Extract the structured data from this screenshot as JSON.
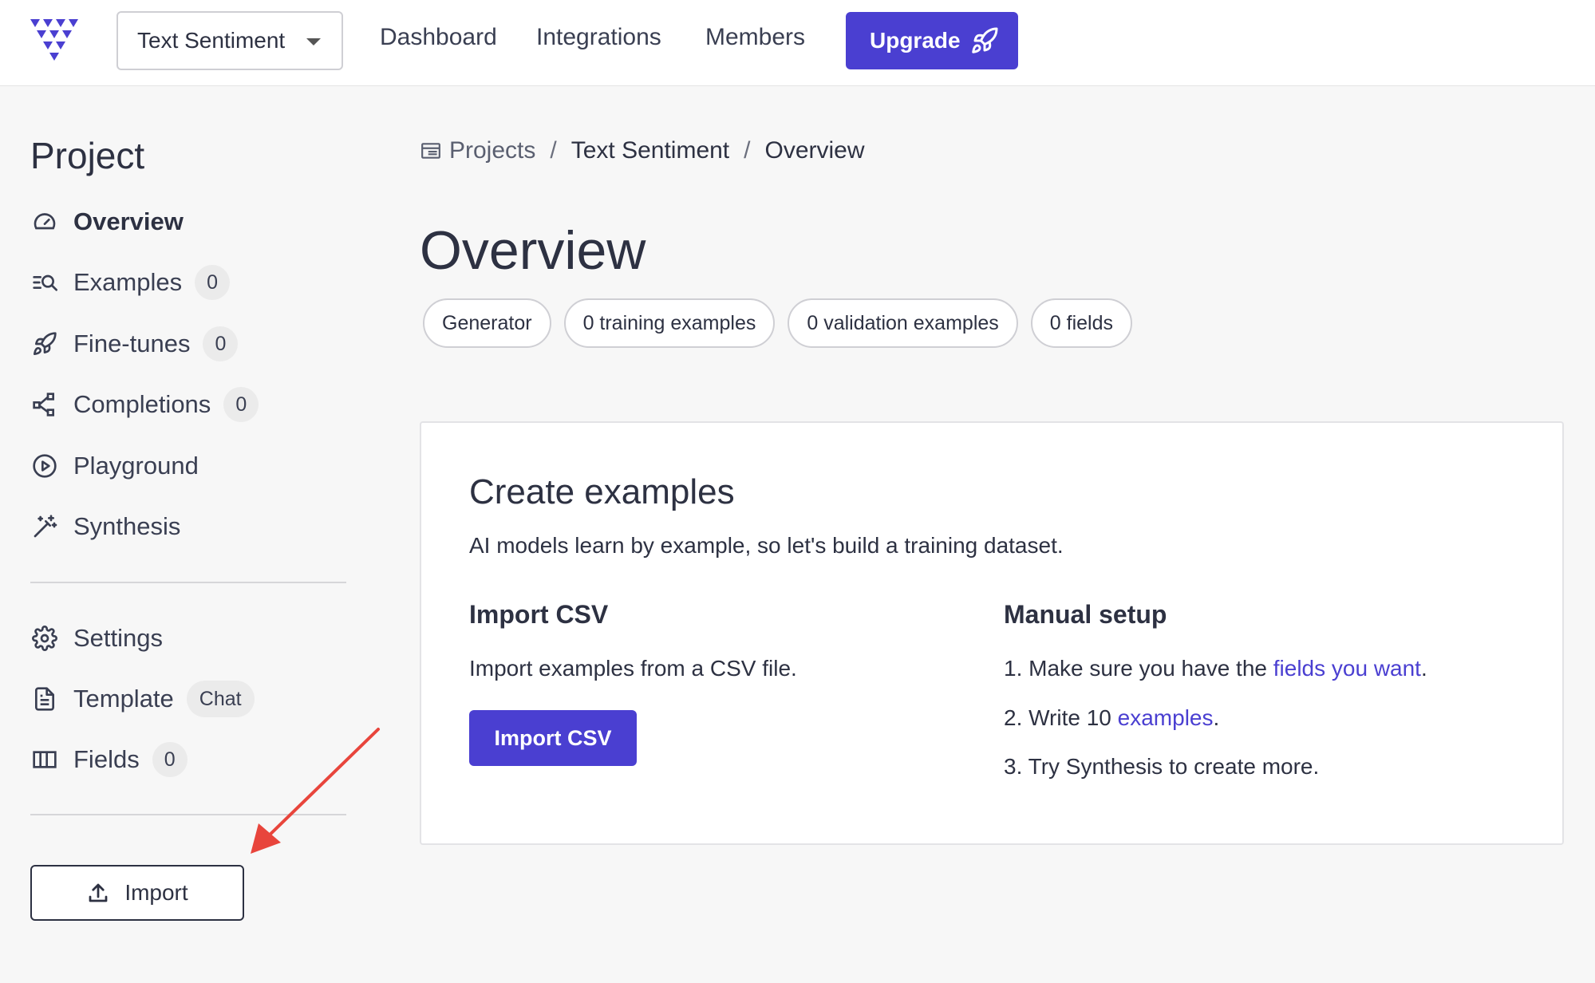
{
  "header": {
    "project_selector": "Text Sentiment",
    "nav": [
      "Dashboard",
      "Integrations",
      "Members"
    ],
    "upgrade_label": "Upgrade"
  },
  "sidebar": {
    "heading": "Project",
    "items": [
      {
        "label": "Overview",
        "icon": "gauge-icon",
        "active": true
      },
      {
        "label": "Examples",
        "icon": "list-search-icon",
        "count": "0"
      },
      {
        "label": "Fine-tunes",
        "icon": "rocket-icon",
        "count": "0"
      },
      {
        "label": "Completions",
        "icon": "share-nodes-icon",
        "count": "0"
      },
      {
        "label": "Playground",
        "icon": "play-circle-icon"
      },
      {
        "label": "Synthesis",
        "icon": "magic-wand-icon"
      }
    ],
    "settings_items": [
      {
        "label": "Settings",
        "icon": "gear-icon"
      },
      {
        "label": "Template",
        "icon": "document-icon",
        "tag": "Chat"
      },
      {
        "label": "Fields",
        "icon": "columns-icon",
        "count": "0"
      }
    ],
    "import_label": "Import"
  },
  "breadcrumb": [
    "Projects",
    "Text Sentiment",
    "Overview"
  ],
  "page_title": "Overview",
  "pills": [
    "Generator",
    "0 training examples",
    "0 validation examples",
    "0 fields"
  ],
  "card": {
    "title": "Create examples",
    "subtitle": "AI models learn by example, so let's build a training dataset.",
    "import_csv": {
      "heading": "Import CSV",
      "text": "Import examples from a CSV file.",
      "button": "Import CSV"
    },
    "manual": {
      "heading": "Manual setup",
      "step1_prefix": "1. Make sure you have the ",
      "step1_link": "fields you want",
      "step1_suffix": ".",
      "step2_prefix": "2. Write 10 ",
      "step2_link": "examples",
      "step2_suffix": ".",
      "step3": "3. Try Synthesis to create more."
    }
  },
  "colors": {
    "accent": "#4a3fd1",
    "annotation_arrow": "#e8453c"
  }
}
